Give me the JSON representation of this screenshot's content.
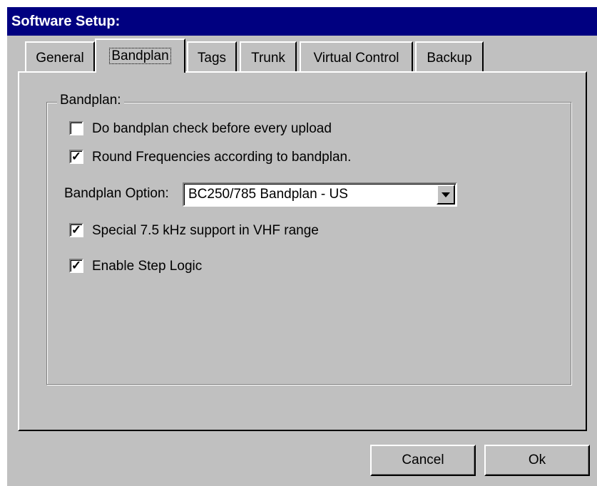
{
  "window": {
    "title": "Software Setup:"
  },
  "tabs": [
    {
      "label": "General",
      "active": false
    },
    {
      "label": "Bandplan",
      "active": true
    },
    {
      "label": "Tags",
      "active": false
    },
    {
      "label": "Trunk",
      "active": false
    },
    {
      "label": "Virtual Control",
      "active": false
    },
    {
      "label": "Backup",
      "active": false
    }
  ],
  "bandplan": {
    "group_label": "Bandplan:",
    "check_before_upload": {
      "label": "Do bandplan check before every upload",
      "checked": false
    },
    "round_frequencies": {
      "label": "Round Frequencies according to bandplan.",
      "checked": true
    },
    "option_label": "Bandplan Option:",
    "option_value": "BC250/785 Bandplan - US",
    "special_vhf": {
      "label": "Special 7.5 kHz support in VHF range",
      "checked": true
    },
    "step_logic": {
      "label": "Enable Step Logic",
      "checked": true
    }
  },
  "buttons": {
    "cancel": "Cancel",
    "ok": "Ok"
  },
  "colors": {
    "titlebar": "#000080",
    "face": "#c0c0c0"
  }
}
